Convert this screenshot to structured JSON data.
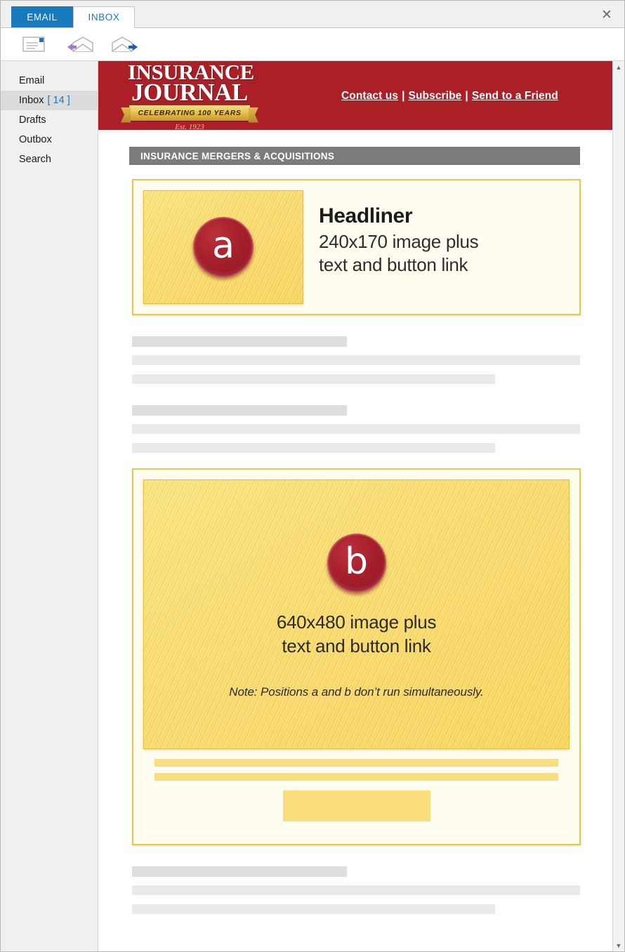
{
  "window": {
    "close_label": "✕"
  },
  "tabs": [
    {
      "label": "EMAIL",
      "state": "active-blue"
    },
    {
      "label": "INBOX",
      "state": "active-white"
    }
  ],
  "toolbar": {
    "buttons": [
      {
        "name": "new-message-icon",
        "title": "New message"
      },
      {
        "name": "reply-icon",
        "title": "Reply"
      },
      {
        "name": "forward-icon",
        "title": "Forward"
      }
    ]
  },
  "sidebar": {
    "items": [
      {
        "label": "Email",
        "count": "",
        "selected": false
      },
      {
        "label": "Inbox",
        "count": "[ 14 ]",
        "selected": true
      },
      {
        "label": "Drafts",
        "count": "",
        "selected": false
      },
      {
        "label": "Outbox",
        "count": "",
        "selected": false
      },
      {
        "label": "Search",
        "count": "",
        "selected": false
      }
    ]
  },
  "email": {
    "masthead": {
      "word1": "INSURANCE",
      "word2": "JOURNAL",
      "ribbon": "CELEBRATING 100 YEARS",
      "established": "Est. 1923",
      "background_color": "#ab1f26",
      "links": [
        {
          "label": "Contact us"
        },
        {
          "label": "Subscribe"
        },
        {
          "label": "Send to a Friend"
        }
      ],
      "link_separator": "|"
    },
    "section_banner": {
      "label": "INSURANCE MERGERS & ACQUISITIONS",
      "background_color": "#7c7c7c"
    },
    "ad_a": {
      "badge_letter": "a",
      "title": "Headliner",
      "subtitle_line1": "240x170 image plus",
      "subtitle_line2": "text and button link",
      "frame_color": "#e8c84a"
    },
    "ad_b": {
      "badge_letter": "b",
      "caption_line1": "640x480 image plus",
      "caption_line2": "text and button link",
      "note": "Note: Positions a and b don’t run simultaneously.",
      "frame_color": "#e8c84a",
      "accent_color": "#fadd7d"
    },
    "placeholder_groups": [
      {
        "lines": 2
      },
      {
        "lines": 2
      },
      {
        "lines": 2
      }
    ]
  },
  "scrollbar": {
    "up_arrow": "▲",
    "down_arrow": "▼"
  }
}
